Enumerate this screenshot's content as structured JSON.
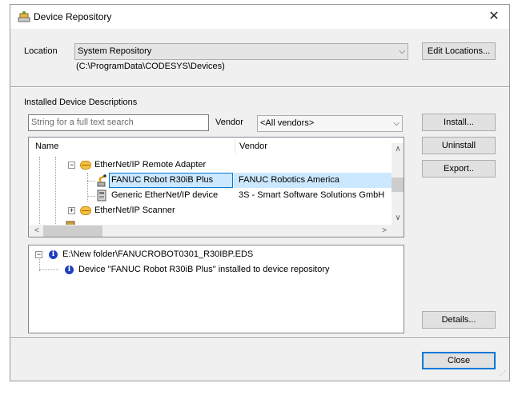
{
  "window": {
    "title": "Device Repository",
    "close_glyph": "✕"
  },
  "location": {
    "label": "Location",
    "selected": "System Repository",
    "path": "(C:\\ProgramData\\CODESYS\\Devices)",
    "edit_button": "Edit Locations..."
  },
  "installed": {
    "label": "Installed Device Descriptions",
    "search_placeholder": "String for a full text search",
    "vendor_label": "Vendor",
    "vendor_selected": "<All vendors>",
    "columns": [
      "Name",
      "Vendor"
    ],
    "rows": [
      {
        "name": "EtherNet/IP Remote Adapter",
        "vendor": "",
        "expander": "−",
        "icon": "ethernet-icon"
      },
      {
        "name": "FANUC Robot R30iB Plus",
        "vendor": "FANUC Robotics America",
        "selected": true,
        "icon": "robot-icon"
      },
      {
        "name": "Generic EtherNet/IP device",
        "vendor": "3S - Smart Software Solutions GmbH",
        "icon": "device-icon"
      },
      {
        "name": "EtherNet/IP Scanner",
        "vendor": "",
        "expander": "+",
        "icon": "ethernet-icon"
      }
    ]
  },
  "buttons": {
    "install": "Install...",
    "uninstall": "Uninstall",
    "export": "Export..",
    "details": "Details...",
    "close": "Close"
  },
  "log": {
    "file": "E:\\New folder\\FANUCROBOT0301_R30IBP.EDS",
    "message": "Device \"FANUC Robot R30iB Plus\" installed to device repository",
    "expander": "−",
    "icon": "info-icon",
    "icon_glyph": "i"
  },
  "scroll_glyphs": {
    "up": "∧",
    "down": "∨",
    "left": "<",
    "right": ">"
  },
  "colors": {
    "selection": "#cce8ff",
    "selection_border": "#0078d7",
    "dialog_bg": "#f0f0f0"
  }
}
